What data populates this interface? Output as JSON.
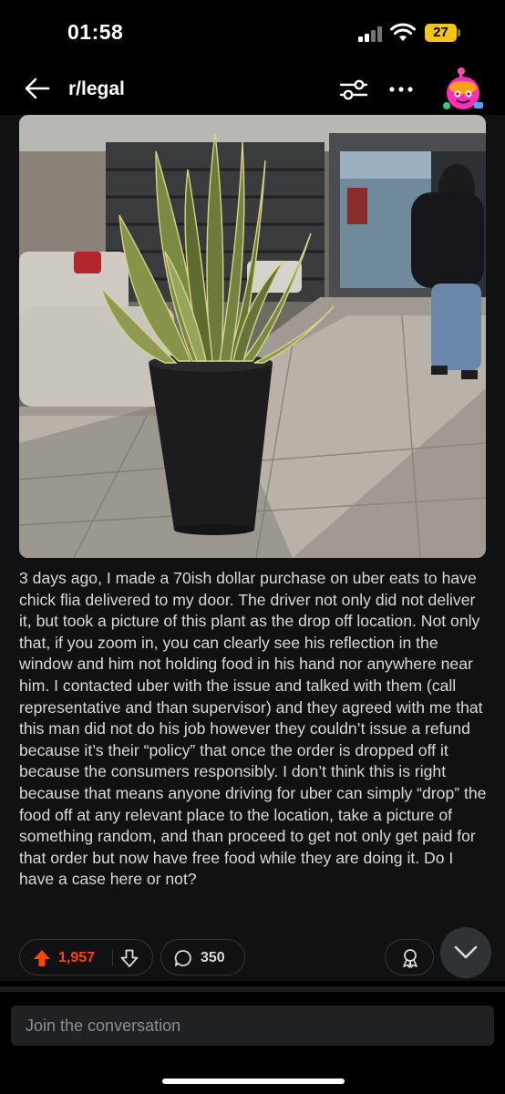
{
  "status_bar": {
    "time": "01:58",
    "battery": "27",
    "icons": [
      "signal-icon",
      "wifi-icon",
      "battery-icon"
    ]
  },
  "header": {
    "subreddit": "r/legal",
    "icons": [
      "back-arrow-icon",
      "filter-icon",
      "more-icon",
      "avatar"
    ]
  },
  "post": {
    "image_description_icon": "photo",
    "body": "3 days ago, I made a 70ish dollar purchase on uber eats to have chick flia delivered to my door. The driver not only did not deliver it, but took a picture of this plant as the drop off location. Not only that, if you zoom in, you can clearly see his reflection in the window and him not holding food in his hand nor anywhere near him. I contacted uber with the issue and talked with them (call representative and than supervisor) and they agreed with me that this man did not do his job however they couldn’t issue a refund because it’s their “policy” that once the order is dropped off it because the consumers responsibly. I don’t think this is right because that means anyone driving for uber can simply “drop” the food off at any relevant place to the location, take a picture of something random, and than proceed to get not only get paid for that order but now have free food while they are doing it. Do I have a case here or not?",
    "upvotes": "1,957",
    "comments": "350"
  },
  "composer": {
    "placeholder": "Join the conversation"
  },
  "colors": {
    "accent_upvote": "#ff4500",
    "background": "#000000",
    "card": "#0f1113",
    "battery": "#f5c518"
  }
}
